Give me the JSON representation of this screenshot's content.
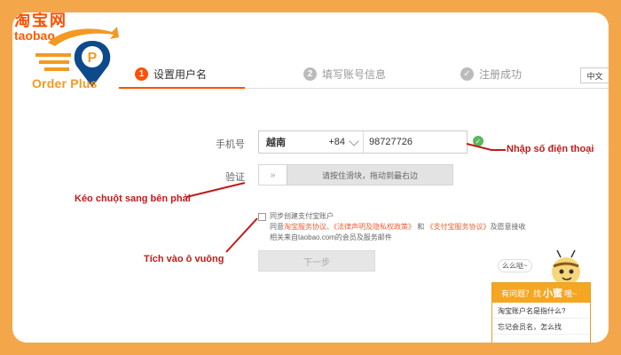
{
  "taobao_logo": {
    "cn": "淘宝网",
    "en": "taobao"
  },
  "brand": {
    "name": "Order Plus"
  },
  "steps": [
    {
      "num": "1",
      "label": "设置用户名",
      "state": "active"
    },
    {
      "num": "2",
      "label": "填写账号信息",
      "state": "pending"
    },
    {
      "num": "",
      "label": "注册成功",
      "state": "pending"
    }
  ],
  "language": "中文",
  "form": {
    "phone_label": "手机号",
    "country": "越南",
    "country_code": "+84",
    "phone_value": "98727726",
    "verify_label": "验证",
    "slider_handle": "»",
    "slider_hint": "请按住滑块，拖动到最右边",
    "agree_line1": "同步创建支付宝账户",
    "agree_prefix": "同意",
    "agree_link1": "淘宝服务协议、《法律声明及隐私权政策》",
    "agree_and": "和",
    "agree_link2": "《支付宝服务协议》",
    "agree_suffix": "及愿意接收",
    "agree_line3": "相关来自taobao.com的会员及服务邮件",
    "next_button": "下一步"
  },
  "annotations": {
    "phone": "Nhập số điện thoại",
    "slider": "Kéo chuột sang bên phải",
    "checkbox": "Tích vào ô vuông"
  },
  "help": {
    "bubble": "么么哒~",
    "title_pre": "有问题？找",
    "title_name": "小蜜",
    "title_post": "哦~",
    "questions": [
      "淘宝账户名是指什么?",
      "忘记会员名，怎么找"
    ]
  },
  "colors": {
    "accent": "#ff5000",
    "annotation": "#c21a1a",
    "frame": "#f3a64a",
    "success": "#5cb85c"
  }
}
